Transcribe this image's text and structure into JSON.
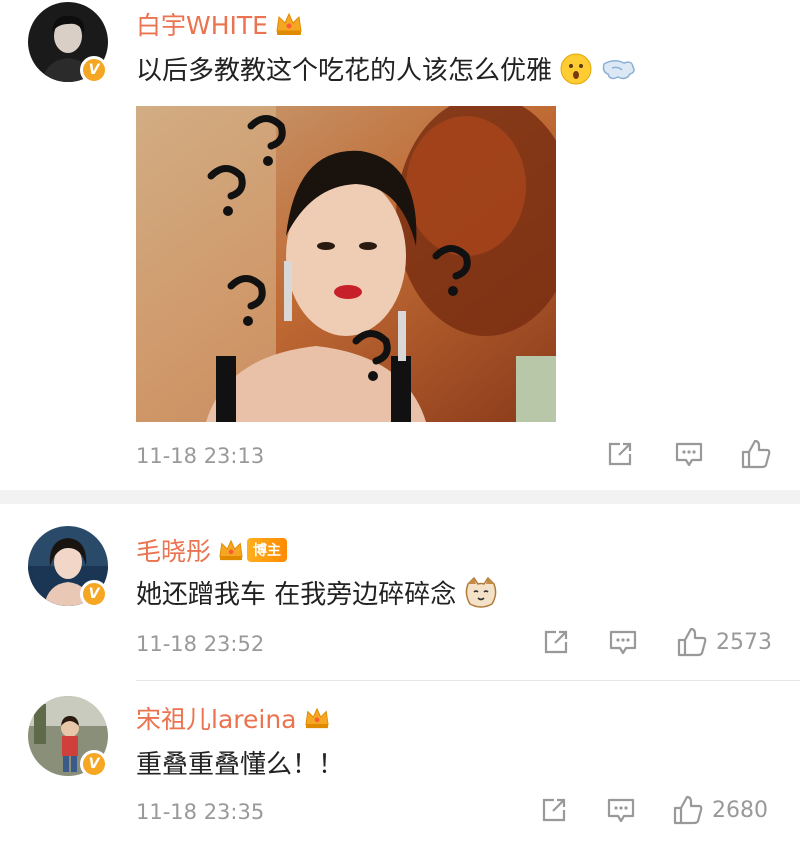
{
  "comments": [
    {
      "name": "白宇WHITE",
      "text": "以后多教教这个吃花的人该怎么优雅",
      "time": "11-18 23:13",
      "emojis": [
        "surprised-emoji",
        "dash-emoji"
      ],
      "verified": "V"
    },
    {
      "name": "毛晓彤",
      "badge": "博主",
      "text": "她还蹭我车 在我旁边碎碎念",
      "time": "11-18 23:52",
      "likes": "2573",
      "emojis": [
        "cat-emoji"
      ],
      "verified": "V"
    },
    {
      "name": "宋祖儿lareina",
      "text": "重叠重叠懂么！！",
      "time": "11-18 23:35",
      "likes": "2680",
      "verified": "V"
    }
  ],
  "colors": {
    "name": "#eb7350",
    "meta": "#999999",
    "badge": "#f5a623"
  }
}
